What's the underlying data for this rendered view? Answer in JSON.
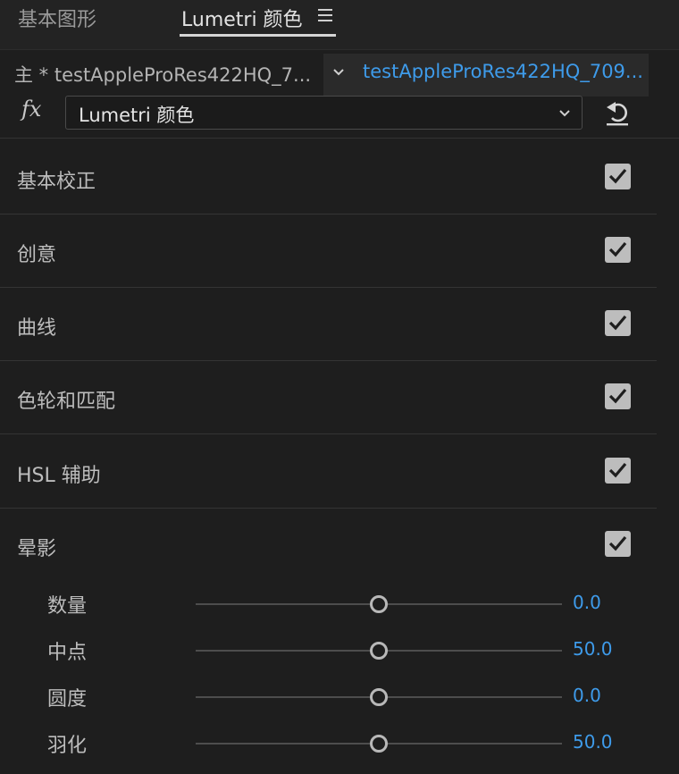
{
  "tabs": [
    {
      "label": "基本图形",
      "active": false
    },
    {
      "label": "Lumetri 颜色",
      "active": true
    }
  ],
  "source": {
    "master_label": "主 * testAppleProRes422HQ_7...",
    "clip_label": "testAppleProRes422HQ_709..."
  },
  "effect": {
    "fx_symbol": "fx",
    "selected": "Lumetri 颜色"
  },
  "sections": [
    {
      "label": "基本校正",
      "checked": true
    },
    {
      "label": "创意",
      "checked": true
    },
    {
      "label": "曲线",
      "checked": true
    },
    {
      "label": "色轮和匹配",
      "checked": true
    },
    {
      "label": "HSL 辅助",
      "checked": true
    },
    {
      "label": "晕影",
      "checked": true
    }
  ],
  "vignette": {
    "params": [
      {
        "label": "数量",
        "value": "0.0",
        "slider_fraction": 0.5
      },
      {
        "label": "中点",
        "value": "50.0",
        "slider_fraction": 0.5
      },
      {
        "label": "圆度",
        "value": "0.0",
        "slider_fraction": 0.5
      },
      {
        "label": "羽化",
        "value": "50.0",
        "slider_fraction": 0.5
      }
    ]
  },
  "colors": {
    "accent": "#3e9bea",
    "background": "#1e1e1e",
    "checkbox": "#bdbdbd"
  },
  "icons": {
    "menu": "hamburger-menu-icon",
    "dropdown": "chevron-down-icon",
    "reset": "reset-icon",
    "check": "checkmark-icon"
  }
}
